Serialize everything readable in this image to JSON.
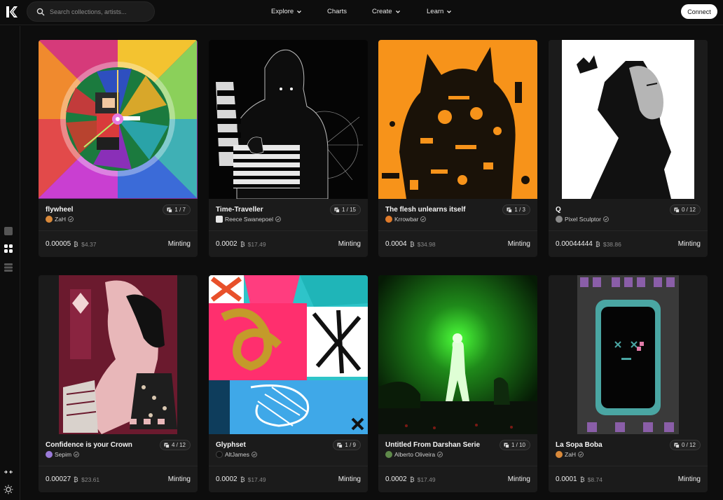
{
  "header": {
    "search_placeholder": "Search collections, artists...",
    "nav": [
      {
        "label": "Explore",
        "has_dropdown": true
      },
      {
        "label": "Charts",
        "has_dropdown": false
      },
      {
        "label": "Create",
        "has_dropdown": true
      },
      {
        "label": "Learn",
        "has_dropdown": true
      }
    ],
    "connect_label": "Connect"
  },
  "sidebar": {
    "icons": [
      "square-icon",
      "grid-view-icon",
      "list-view-icon",
      "collapse-icon",
      "theme-sun-icon"
    ]
  },
  "cards": [
    {
      "title": "flywheel",
      "edition": "1 / 7",
      "artist": "ZaH",
      "avatar_color": "#d9893a",
      "price": "0.00005",
      "usd": "$4.37",
      "status": "Minting"
    },
    {
      "title": "Time-Traveller",
      "edition": "1 / 15",
      "artist": "Reece Swanepoel",
      "avatar_color": "#e6e6e6",
      "price": "0.0002",
      "usd": "$17.49",
      "status": "Minting"
    },
    {
      "title": "The flesh unlearns itself",
      "edition": "1 / 3",
      "artist": "Krrowbar",
      "avatar_color": "#e07b2b",
      "price": "0.0004",
      "usd": "$34.98",
      "status": "Minting"
    },
    {
      "title": "Q",
      "edition": "0 / 12",
      "artist": "Pixel Sculptor",
      "avatar_color": "#8a8a8a",
      "price": "0.00044444",
      "usd": "$38.86",
      "status": "Minting"
    },
    {
      "title": "Confidence is your Crown",
      "edition": "4 / 12",
      "artist": "Sepim",
      "avatar_color": "#9a7ad8",
      "price": "0.00027",
      "usd": "$23.61",
      "status": "Minting"
    },
    {
      "title": "Glyphset",
      "edition": "1 / 9",
      "artist": "AltJames",
      "avatar_color": "#111111",
      "price": "0.0002",
      "usd": "$17.49",
      "status": "Minting"
    },
    {
      "title": "Untitled From Darshan Serie",
      "edition": "1 / 10",
      "artist": "Alberto Oliveira",
      "avatar_color": "#5f8a4a",
      "price": "0.0002",
      "usd": "$17.49",
      "status": "Minting"
    },
    {
      "title": "La Sopa Boba",
      "edition": "0 / 12",
      "artist": "ZaH",
      "avatar_color": "#d9893a",
      "price": "0.0001",
      "usd": "$8.74",
      "status": "Minting"
    }
  ],
  "colors": {
    "background": "#0d0d0d",
    "card": "#1b1b1b",
    "accent_orange": "#f7931a"
  }
}
